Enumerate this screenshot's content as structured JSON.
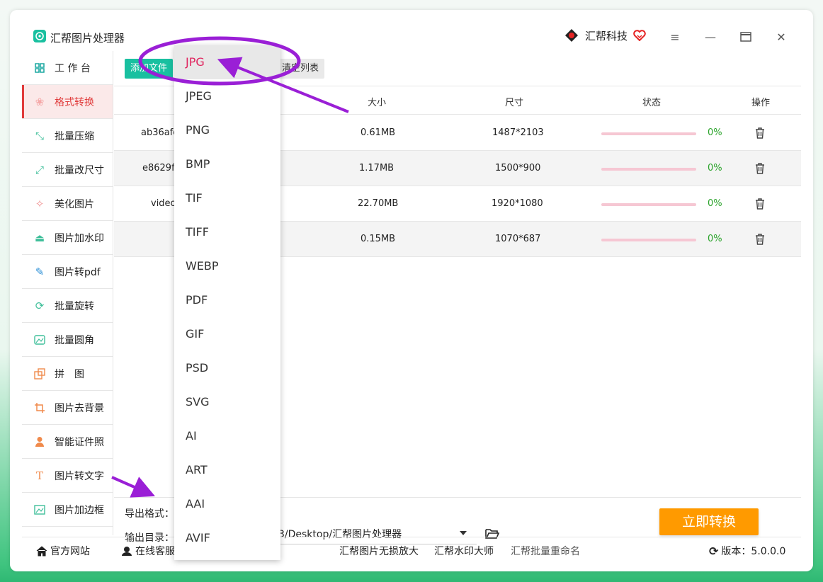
{
  "app": {
    "title": "汇帮图片处理器",
    "brand": "汇帮科技"
  },
  "sidebar": {
    "items": [
      {
        "label": "工 作 台",
        "icon": "grid-icon",
        "active": false
      },
      {
        "label": "格式转换",
        "icon": "format-convert-icon",
        "active": true
      },
      {
        "label": "批量压缩",
        "icon": "compress-icon",
        "active": false
      },
      {
        "label": "批量改尺寸",
        "icon": "resize-icon",
        "active": false
      },
      {
        "label": "美化图片",
        "icon": "beautify-icon",
        "active": false
      },
      {
        "label": "图片加水印",
        "icon": "watermark-icon",
        "active": false
      },
      {
        "label": "图片转pdf",
        "icon": "pdf-icon",
        "active": false
      },
      {
        "label": "批量旋转",
        "icon": "rotate-icon",
        "active": false
      },
      {
        "label": "批量圆角",
        "icon": "round-corner-icon",
        "active": false
      },
      {
        "label": "拼　图",
        "icon": "collage-icon",
        "active": false
      },
      {
        "label": "图片去背景",
        "icon": "crop-icon",
        "active": false
      },
      {
        "label": "智能证件照",
        "icon": "person-icon",
        "active": false
      },
      {
        "label": "图片转文字",
        "icon": "text-icon",
        "active": false
      },
      {
        "label": "图片加边框",
        "icon": "frame-icon",
        "active": false
      }
    ]
  },
  "toolbar": {
    "add_label": "添加文件",
    "clear_label": "清空列表"
  },
  "table": {
    "headers": {
      "size": "大小",
      "dimensions": "尺寸",
      "status": "状态",
      "action": "操作"
    },
    "rows": [
      {
        "name": "ab36afe",
        "size": "0.61MB",
        "dimensions": "1487*2103",
        "progress": 0,
        "pct": "0%"
      },
      {
        "name": "e8629fd",
        "size": "1.17MB",
        "dimensions": "1500*900",
        "progress": 0,
        "pct": "0%"
      },
      {
        "name": "video",
        "size": "22.70MB",
        "dimensions": "1920*1080",
        "progress": 0,
        "pct": "0%"
      },
      {
        "name": "",
        "size": "0.15MB",
        "dimensions": "1070*687",
        "progress": 0,
        "pct": "0%"
      }
    ]
  },
  "output": {
    "format_label": "导出格式：",
    "dir_label": "输出目录：",
    "dir_value": "3/Desktop/汇帮图片处理器",
    "convert_label": "立即转换"
  },
  "footer": {
    "website": "官方网站",
    "service": "在线客服",
    "link1": "汇帮图片无损放大",
    "link2": "汇帮水印大师",
    "link3": "汇帮批量重命名",
    "version": "版本：5.0.0.0"
  },
  "format_dropdown": {
    "selected": "JPG",
    "options": [
      "JPG",
      "JPEG",
      "PNG",
      "BMP",
      "TIF",
      "TIFF",
      "WEBP",
      "PDF",
      "GIF",
      "PSD",
      "SVG",
      "AI",
      "ART",
      "AAI",
      "AVIF"
    ]
  },
  "colors": {
    "accent_red": "#e03b3b",
    "teal": "#19c0a0",
    "orange": "#ff9a00",
    "annotation_purple": "#9a1fd6"
  }
}
